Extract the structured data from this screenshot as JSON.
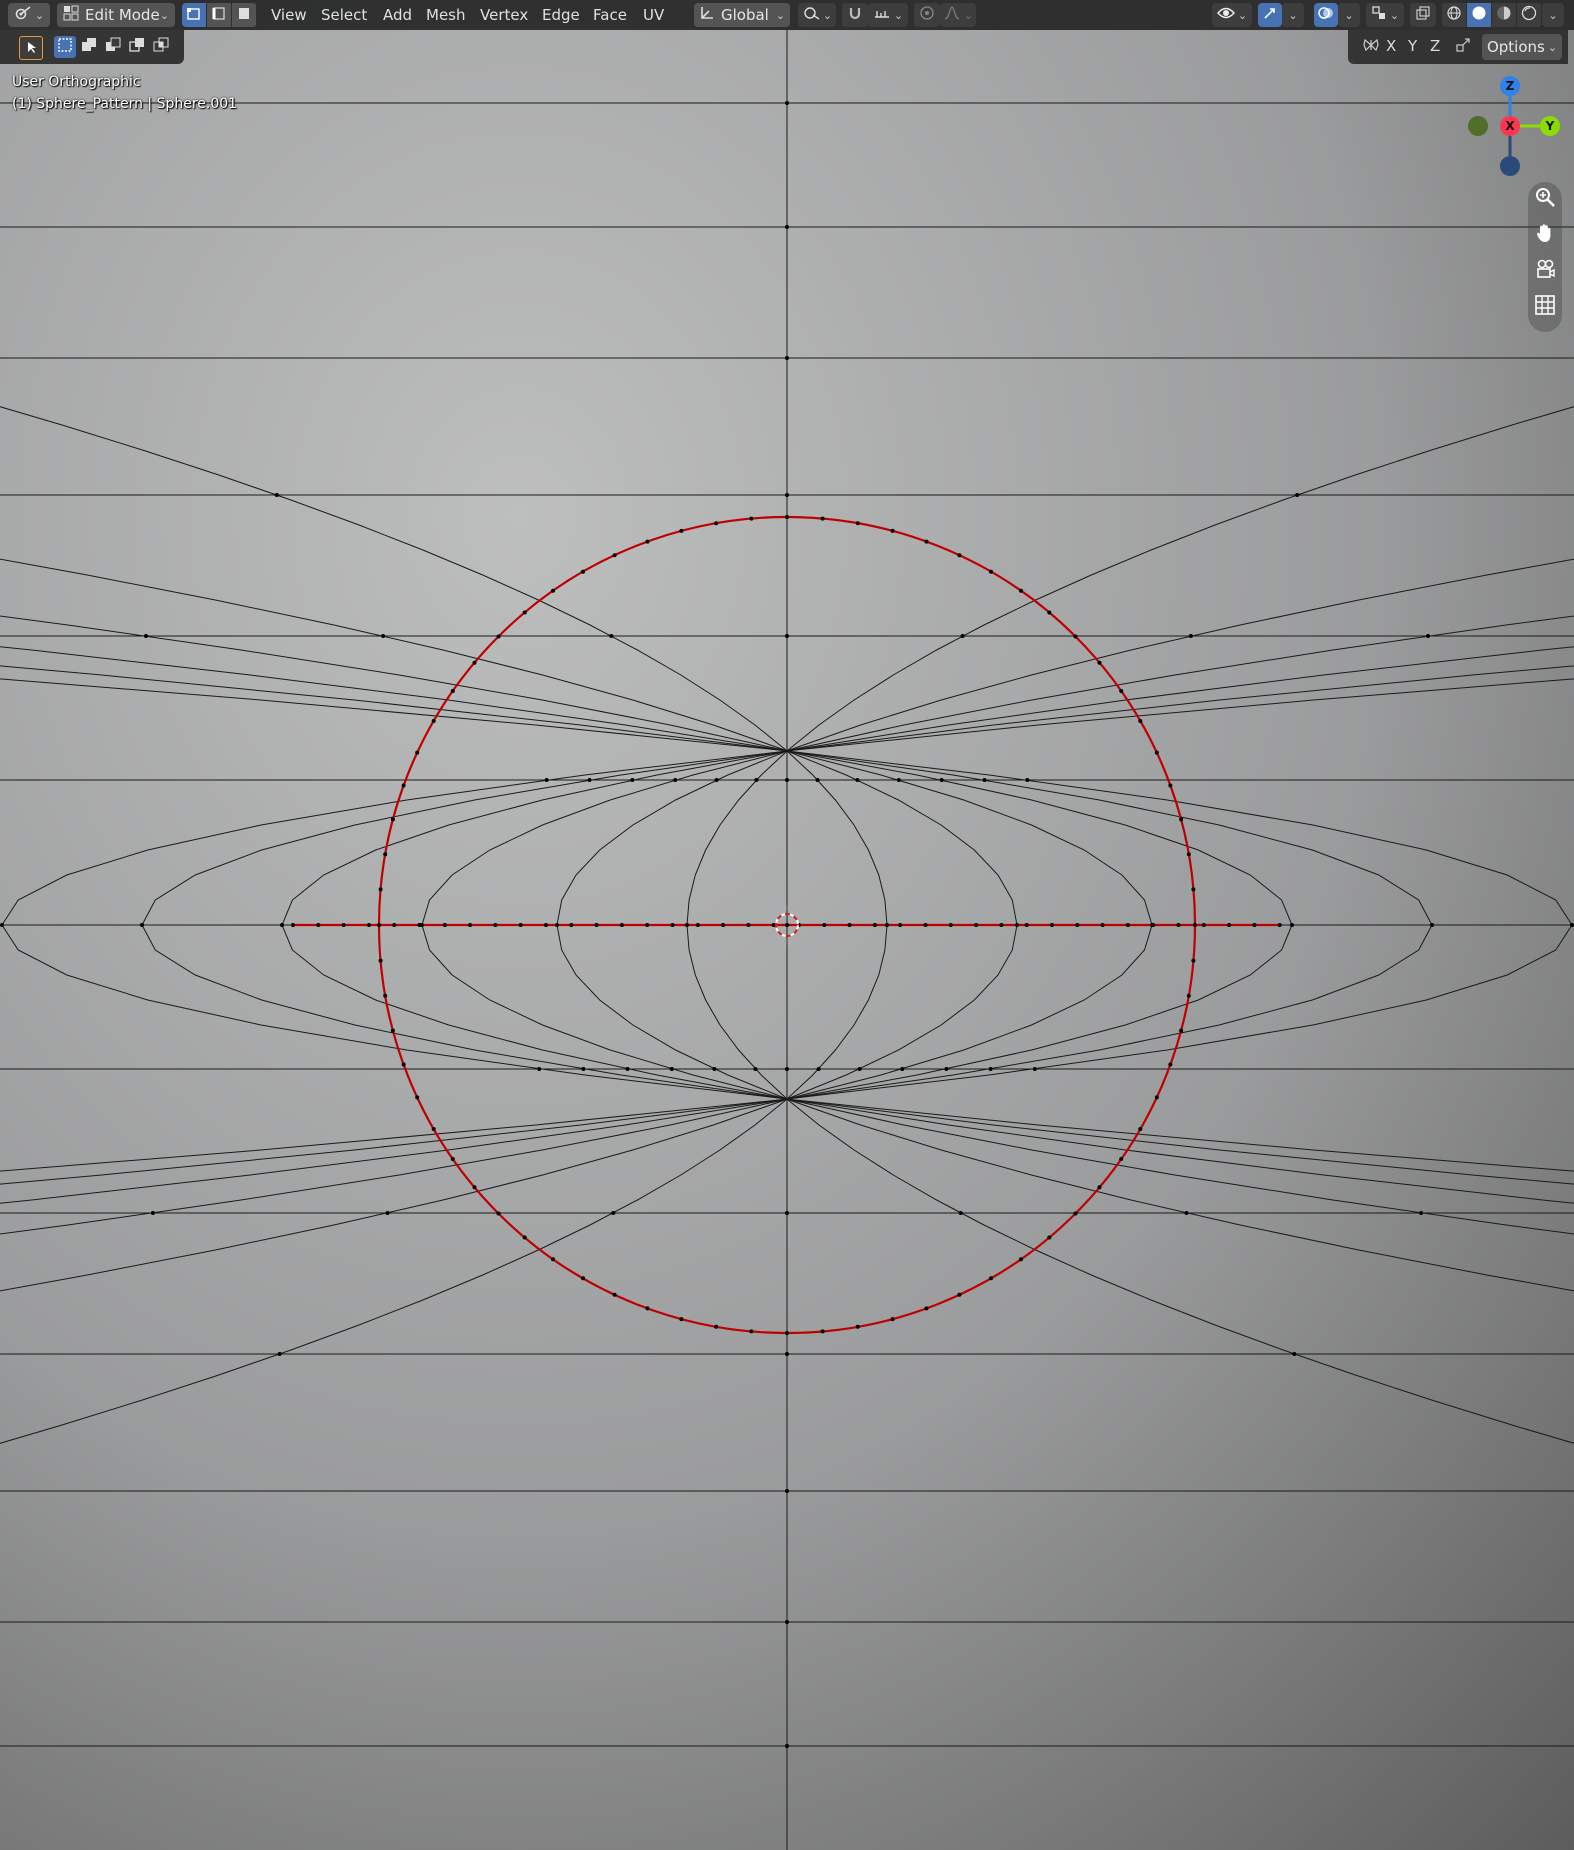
{
  "header": {
    "editor_type_icon": "editor-type-icon",
    "mode": "Edit Mode",
    "menus": [
      "View",
      "Select",
      "Add",
      "Mesh",
      "Vertex",
      "Edge",
      "Face",
      "UV"
    ],
    "transform_orientation": "Global",
    "options_label": "Options",
    "axis_labels": [
      "X",
      "Y",
      "Z"
    ]
  },
  "viewport": {
    "view_name": "User Orthographic",
    "object_info": "(1) Sphere_Pattern | Sphere.001"
  },
  "gizmo": {
    "z_label": "Z",
    "x_label": "X",
    "y_label": "Y",
    "colors": {
      "x": "#ff3352",
      "y": "#8bdc00",
      "z": "#2f83e8",
      "neg_y": "#4f6e2a",
      "neg_z": "#2a4a78"
    }
  },
  "colors": {
    "header_bg": "#2b2b2b",
    "button_bg": "#545454",
    "active_blue": "#4772b3",
    "selected_edge": "#c00000",
    "vertex": "#000000",
    "wire": "#1a1a1a"
  }
}
